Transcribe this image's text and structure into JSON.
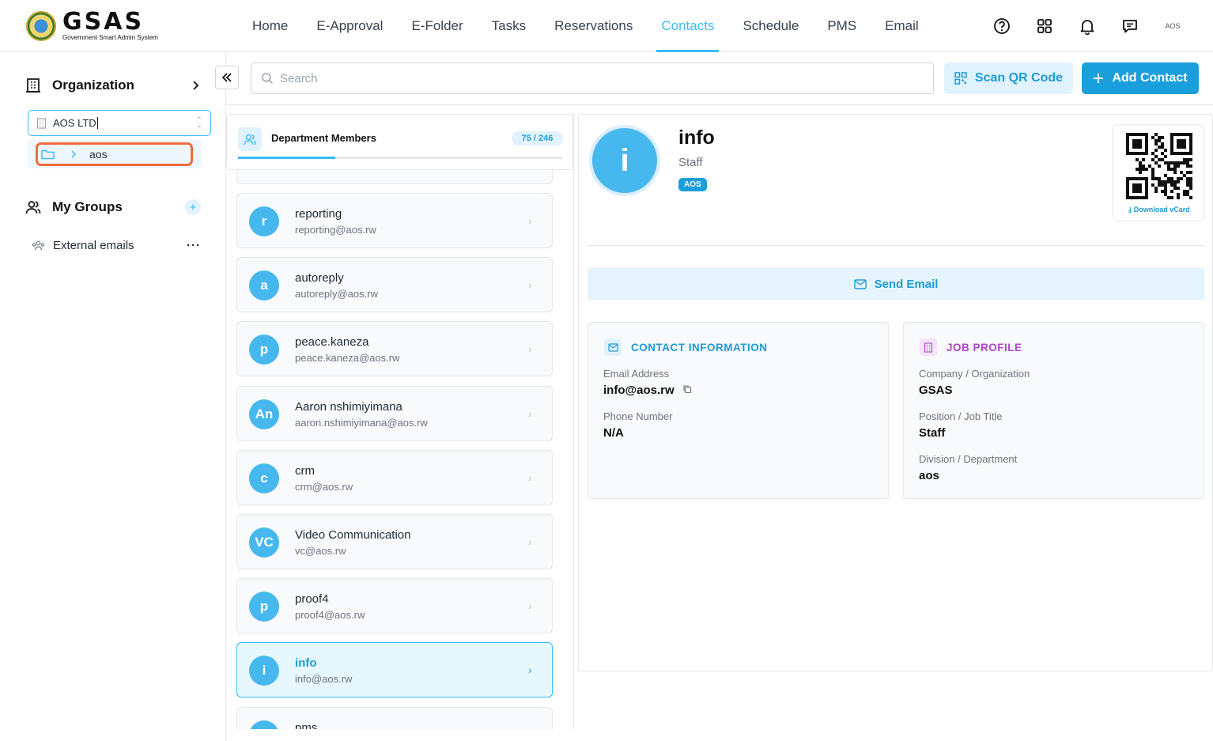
{
  "brand": {
    "title": "GSAS",
    "subtitle": "Government Smart Admin System"
  },
  "nav": [
    "Home",
    "E-Approval",
    "E-Folder",
    "Tasks",
    "Reservations",
    "Contacts",
    "Schedule",
    "PMS",
    "Email"
  ],
  "nav_active": "Contacts",
  "user": {
    "avatar_text": "AOS"
  },
  "sidebar": {
    "org_label": "Organization",
    "org_select": "AOS LTD",
    "tree_item": "aos",
    "groups_label": "My Groups",
    "group_item": "External emails"
  },
  "toolbar": {
    "search_placeholder": "Search",
    "scan_label": "Scan QR Code",
    "add_label": "Add Contact"
  },
  "list": {
    "title": "Department Members",
    "count": "75 / 246",
    "progress_fraction": 0.3,
    "items": [
      {
        "initials": "r",
        "name": "reporting",
        "email": "reporting@aos.rw"
      },
      {
        "initials": "a",
        "name": "autoreply",
        "email": "autoreply@aos.rw"
      },
      {
        "initials": "p",
        "name": "peace.kaneza",
        "email": "peace.kaneza@aos.rw"
      },
      {
        "initials": "An",
        "name": "Aaron nshimiyimana",
        "email": "aaron.nshimiyimana@aos.rw"
      },
      {
        "initials": "c",
        "name": "crm",
        "email": "crm@aos.rw"
      },
      {
        "initials": "VC",
        "name": "Video Communication",
        "email": "vc@aos.rw"
      },
      {
        "initials": "p",
        "name": "proof4",
        "email": "proof4@aos.rw"
      },
      {
        "initials": "i",
        "name": "info",
        "email": "info@aos.rw"
      },
      {
        "initials": "p",
        "name": "pms",
        "email": ""
      }
    ]
  },
  "detail": {
    "initial": "i",
    "name": "info",
    "role": "Staff",
    "badge": "AOS",
    "download_label": "Download vCard",
    "send_email": "Send Email",
    "contact": {
      "title": "CONTACT INFORMATION",
      "email_label": "Email Address",
      "email": "info@aos.rw",
      "phone_label": "Phone Number",
      "phone": "N/A"
    },
    "job": {
      "title": "JOB PROFILE",
      "company_label": "Company / Organization",
      "company": "GSAS",
      "position_label": "Position / Job Title",
      "position": "Staff",
      "division_label": "Division / Department",
      "division": "aos"
    }
  },
  "colors": {
    "accent": "#38bdf8",
    "primary": "#1a9fdc",
    "purple": "#b042c9",
    "highlight": "#f26b3a"
  }
}
